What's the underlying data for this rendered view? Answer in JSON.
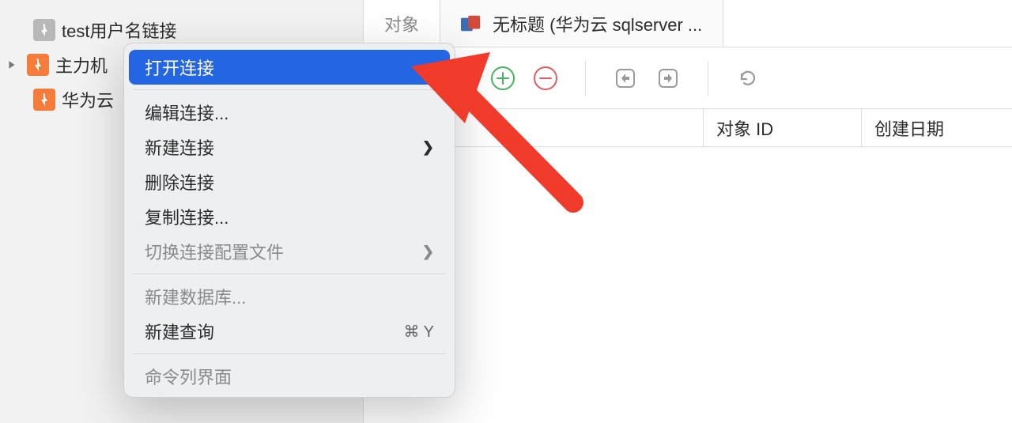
{
  "sidebar": {
    "items": [
      {
        "label": "test用户名链接",
        "expandable": false,
        "grey": true
      },
      {
        "label": "主力机",
        "expandable": true,
        "grey": false
      },
      {
        "label": "华为云",
        "expandable": false,
        "grey": false
      }
    ]
  },
  "tabs": [
    {
      "label": "对象",
      "active": false
    },
    {
      "label": "无标题 (华为云 sqlserver ...",
      "active": true
    }
  ],
  "toolbar": {
    "add_icon": "plus-circle",
    "delete_icon": "minus-circle",
    "import_icon": "import",
    "export_icon": "export",
    "refresh_icon": "refresh"
  },
  "columns": {
    "col1": "对象 ID",
    "col2": "创建日期"
  },
  "context_menu": {
    "items": [
      {
        "label": "打开连接",
        "selected": true
      },
      {
        "sep": true
      },
      {
        "label": "编辑连接..."
      },
      {
        "label": "新建连接",
        "submenu": true
      },
      {
        "label": "删除连接"
      },
      {
        "label": "复制连接..."
      },
      {
        "label": "切换连接配置文件",
        "submenu": true,
        "disabled": true
      },
      {
        "sep": true
      },
      {
        "label": "新建数据库...",
        "disabled": true
      },
      {
        "label": "新建查询",
        "shortcut": "⌘ Y"
      },
      {
        "sep": true
      },
      {
        "label": "命令列界面",
        "disabled": true
      }
    ]
  },
  "annotation": {
    "type": "arrow",
    "color": "#f03b2b"
  }
}
